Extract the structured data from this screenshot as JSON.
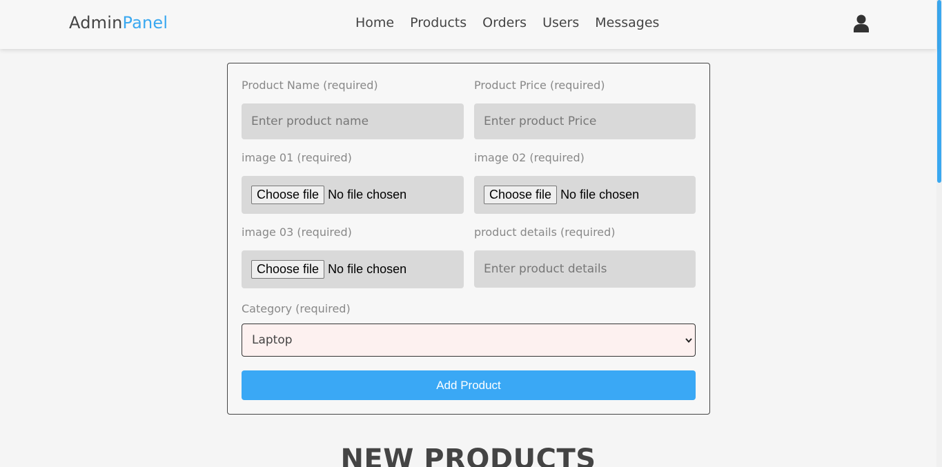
{
  "header": {
    "logo_part1": "Admin",
    "logo_part2": "Panel",
    "nav": [
      "Home",
      "Products",
      "Orders",
      "Users",
      "Messages"
    ],
    "user_icon": "user-icon"
  },
  "form": {
    "product_name": {
      "label": "Product Name (required)",
      "placeholder": "Enter product name",
      "value": ""
    },
    "product_price": {
      "label": "Product Price (required)",
      "placeholder": "Enter product Price",
      "value": ""
    },
    "image01": {
      "label": "image 01 (required)",
      "button": "Choose file",
      "status": "No file chosen"
    },
    "image02": {
      "label": "image 02 (required)",
      "button": "Choose file",
      "status": "No file chosen"
    },
    "image03": {
      "label": "image 03 (required)",
      "button": "Choose file",
      "status": "No file chosen"
    },
    "product_details": {
      "label": "product details (required)",
      "placeholder": "Enter product details",
      "value": ""
    },
    "category": {
      "label": "Category (required)",
      "selected": "Laptop"
    },
    "submit_label": "Add Product"
  },
  "section_title": "NEW PRODUCTS",
  "colors": {
    "accent": "#3aa8f0",
    "button": "#3aa8f5",
    "field_bg": "#d9d9d9",
    "select_bg": "#fdf1f0"
  }
}
